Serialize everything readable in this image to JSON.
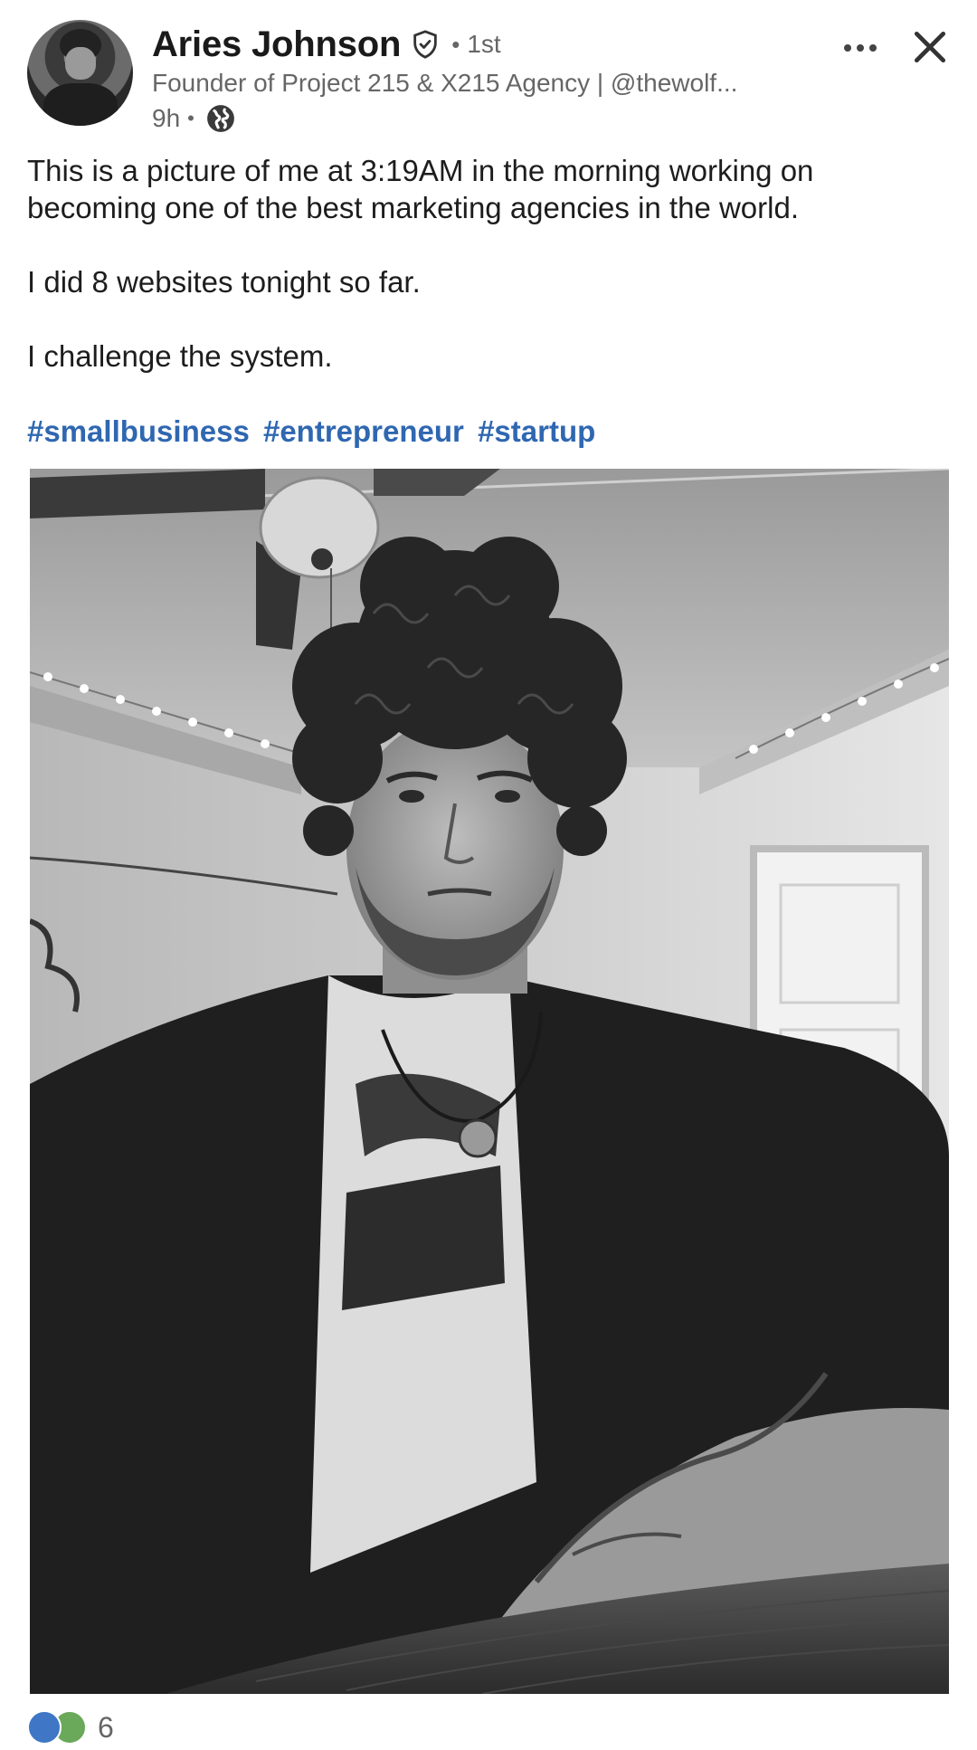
{
  "author": {
    "name": "Aries Johnson",
    "connection_degree": "1st",
    "headline": "Founder of Project 215 & X215 Agency | @thewolf...",
    "time_ago": "9h",
    "visibility_icon": "globe-icon"
  },
  "post": {
    "paragraphs": [
      "This is a picture of me at 3:19AM in the morning working on becoming one of the best marketing agencies in the world.",
      "I did 8 websites tonight so far.",
      "I challenge the system."
    ],
    "hashtags": [
      "#smallbusiness",
      "#entrepreneur",
      "#startup"
    ]
  },
  "reactions": {
    "icons": [
      "like-icon",
      "celebrate-icon"
    ],
    "count": "6"
  },
  "colors": {
    "hashtag": "#2f67b1",
    "secondary_text": "#666666"
  }
}
